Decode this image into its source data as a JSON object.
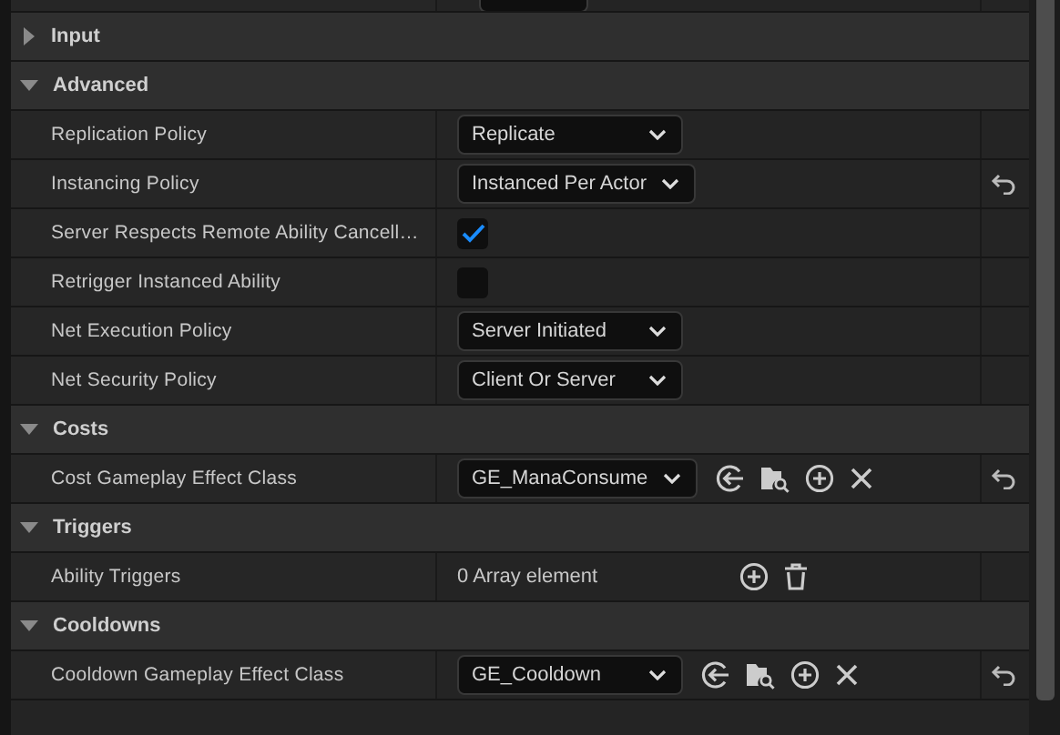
{
  "sections": [
    {
      "title": "Input",
      "expanded": false
    },
    {
      "title": "Advanced",
      "expanded": true,
      "rows": [
        {
          "label": "Replication Policy",
          "kind": "dropdown",
          "value": "Replicate",
          "resettable": false
        },
        {
          "label": "Instancing Policy",
          "kind": "dropdown",
          "value": "Instanced Per Actor",
          "resettable": true
        },
        {
          "label": "Server Respects Remote Ability Cancell…",
          "kind": "checkbox",
          "checked": true,
          "resettable": false
        },
        {
          "label": "Retrigger Instanced Ability",
          "kind": "checkbox",
          "checked": false,
          "resettable": false
        },
        {
          "label": "Net Execution Policy",
          "kind": "dropdown",
          "value": "Server Initiated",
          "resettable": false
        },
        {
          "label": "Net Security Policy",
          "kind": "dropdown",
          "value": "Client Or Server",
          "resettable": false
        }
      ]
    },
    {
      "title": "Costs",
      "expanded": true,
      "rows": [
        {
          "label": "Cost Gameplay Effect Class",
          "kind": "class",
          "value": "GE_ManaConsume",
          "resettable": true
        }
      ]
    },
    {
      "title": "Triggers",
      "expanded": true,
      "rows": [
        {
          "label": "Ability Triggers",
          "kind": "array",
          "value": "0 Array element",
          "resettable": false
        }
      ]
    },
    {
      "title": "Cooldowns",
      "expanded": true,
      "rows": [
        {
          "label": "Cooldown Gameplay Effect Class",
          "kind": "class",
          "value": "GE_Cooldown",
          "resettable": true
        }
      ]
    }
  ]
}
